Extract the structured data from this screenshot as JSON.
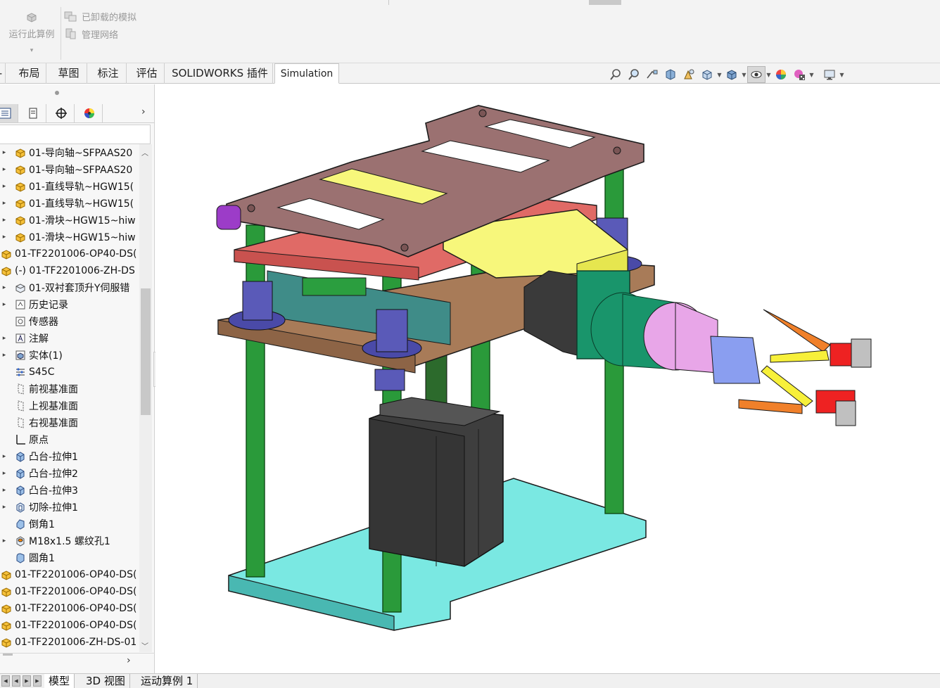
{
  "ribbon": {
    "run_study_label": "运行此算例",
    "run_study_caret": "▾",
    "unloaded_simulation_label": "已卸载的模拟",
    "manage_network_label": "管理网络"
  },
  "tabs": [
    {
      "label": "‐"
    },
    {
      "label": "布局"
    },
    {
      "label": "草图"
    },
    {
      "label": "标注"
    },
    {
      "label": "评估"
    },
    {
      "label": "SOLIDWORKS 插件"
    },
    {
      "label": "Simulation"
    }
  ],
  "feature_tree": [
    {
      "label": "01-导向轴~SFPAAS20",
      "icon": "part-gear-icon",
      "indent": 1,
      "expand": true
    },
    {
      "label": "01-导向轴~SFPAAS20",
      "icon": "part-gear-icon",
      "indent": 1,
      "expand": true
    },
    {
      "label": "01-直线导轨~HGW15(",
      "icon": "part-gear-icon",
      "indent": 1,
      "expand": true
    },
    {
      "label": "01-直线导轨~HGW15(",
      "icon": "part-gear-icon",
      "indent": 1,
      "expand": true
    },
    {
      "label": "01-滑块~HGW15~hiw",
      "icon": "part-gear-icon",
      "indent": 1,
      "expand": true
    },
    {
      "label": "01-滑块~HGW15~hiw",
      "icon": "part-gear-icon",
      "indent": 1,
      "expand": true
    },
    {
      "label": "01-TF2201006-OP40-DS(",
      "icon": "part-gear-icon",
      "indent": 0,
      "expand": false
    },
    {
      "label": "(-) 01-TF2201006-ZH-DS",
      "icon": "part-gear-icon",
      "indent": 0,
      "expand": false
    },
    {
      "label": "01-双衬套顶升Y伺服错",
      "icon": "part-sub-icon",
      "indent": 1,
      "expand": true
    },
    {
      "label": "历史记录",
      "icon": "history-icon",
      "indent": 1,
      "expand": true
    },
    {
      "label": "传感器",
      "icon": "sensor-icon",
      "indent": 1,
      "expand": false
    },
    {
      "label": "注解",
      "icon": "annotation-icon",
      "indent": 1,
      "expand": true
    },
    {
      "label": "实体(1)",
      "icon": "solid-body-icon",
      "indent": 1,
      "expand": true
    },
    {
      "label": "S45C",
      "icon": "material-icon",
      "indent": 1,
      "expand": false
    },
    {
      "label": "前视基准面",
      "icon": "plane-icon",
      "indent": 1,
      "expand": false
    },
    {
      "label": "上视基准面",
      "icon": "plane-icon",
      "indent": 1,
      "expand": false
    },
    {
      "label": "右视基准面",
      "icon": "plane-icon",
      "indent": 1,
      "expand": false
    },
    {
      "label": "原点",
      "icon": "origin-icon",
      "indent": 1,
      "expand": false
    },
    {
      "label": "凸台-拉伸1",
      "icon": "boss-extrude-icon",
      "indent": 1,
      "expand": true
    },
    {
      "label": "凸台-拉伸2",
      "icon": "boss-extrude-icon",
      "indent": 1,
      "expand": true
    },
    {
      "label": "凸台-拉伸3",
      "icon": "boss-extrude-icon",
      "indent": 1,
      "expand": true
    },
    {
      "label": "切除-拉伸1",
      "icon": "cut-extrude-icon",
      "indent": 1,
      "expand": true
    },
    {
      "label": "倒角1",
      "icon": "chamfer-icon",
      "indent": 1,
      "expand": false
    },
    {
      "label": "M18x1.5 螺纹孔1",
      "icon": "hole-icon",
      "indent": 1,
      "expand": true
    },
    {
      "label": "圆角1",
      "icon": "fillet-icon",
      "indent": 1,
      "expand": false
    },
    {
      "label": "01-TF2201006-OP40-DS(",
      "icon": "part-gear-icon",
      "indent": 0,
      "expand": false
    },
    {
      "label": "01-TF2201006-OP40-DS(",
      "icon": "part-gear-icon",
      "indent": 0,
      "expand": false
    },
    {
      "label": "01-TF2201006-OP40-DS(",
      "icon": "part-gear-icon",
      "indent": 0,
      "expand": false
    },
    {
      "label": "01-TF2201006-OP40-DS(",
      "icon": "part-gear-icon",
      "indent": 0,
      "expand": false
    },
    {
      "label": "01-TF2201006-ZH-DS-01",
      "icon": "part-gear-icon",
      "indent": 0,
      "expand": false
    }
  ],
  "bottom_tabs": [
    {
      "label": "模型"
    },
    {
      "label": "3D 视图"
    },
    {
      "label": "运动算例 1"
    }
  ],
  "colors": {
    "top_plate": "#9b7171",
    "red_plate": "#e06a66",
    "yellow_block": "#f7f77b",
    "brown_plate": "#a87b58",
    "teal_rail": "#3f8c88",
    "green_shaft": "#2a9a3a",
    "blue_bushing": "#4a4aa8",
    "cyan_base": "#7ae8e2",
    "motor_green": "#19956b",
    "pink": "#e8a6e8",
    "light_blue": "#8a9ef0",
    "orange": "#f0802a",
    "red_tip": "#ee2222",
    "dark_cylinder": "#3e3e3e"
  }
}
